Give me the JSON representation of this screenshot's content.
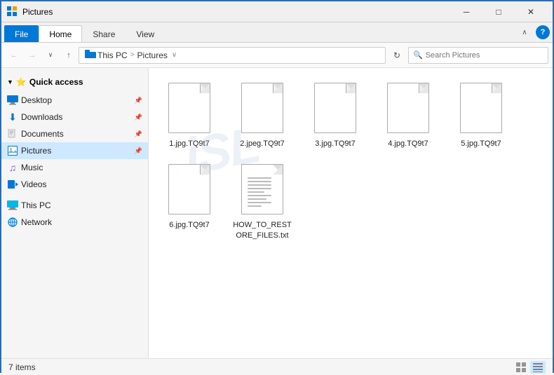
{
  "window": {
    "title": "Pictures",
    "icon": "📁"
  },
  "title_bar": {
    "title": "Pictures",
    "minimize": "─",
    "maximize": "□",
    "close": "✕"
  },
  "ribbon": {
    "tabs": [
      "File",
      "Home",
      "Share",
      "View"
    ],
    "active_tab": "Home",
    "file_tab": "File"
  },
  "address_bar": {
    "back": "←",
    "forward": "→",
    "up": "↑",
    "recent_dropdown": "∨",
    "path": "This PC  ›  Pictures",
    "path_parts": [
      "This PC",
      "Pictures"
    ],
    "dropdown_arrow": "∨",
    "refresh": "⟳",
    "search_placeholder": "Search Pictures"
  },
  "sidebar": {
    "quick_access_label": "Quick access",
    "items": [
      {
        "id": "desktop",
        "label": "Desktop",
        "icon": "🖥",
        "pinned": true
      },
      {
        "id": "downloads",
        "label": "Downloads",
        "icon": "⬇",
        "pinned": true
      },
      {
        "id": "documents",
        "label": "Documents",
        "icon": "📄",
        "pinned": true
      },
      {
        "id": "pictures",
        "label": "Pictures",
        "icon": "🖼",
        "pinned": true,
        "active": true
      },
      {
        "id": "music",
        "label": "Music",
        "icon": "🎵",
        "pinned": false
      },
      {
        "id": "videos",
        "label": "Videos",
        "icon": "📹",
        "pinned": false
      },
      {
        "id": "this-pc",
        "label": "This PC",
        "icon": "💻",
        "pinned": false
      },
      {
        "id": "network",
        "label": "Network",
        "icon": "🌐",
        "pinned": false
      }
    ]
  },
  "files": [
    {
      "id": 1,
      "name": "1.jpg.TQ9t7",
      "type": "doc"
    },
    {
      "id": 2,
      "name": "2.jpeg.TQ9t7",
      "type": "doc"
    },
    {
      "id": 3,
      "name": "3.jpg.TQ9t7",
      "type": "doc"
    },
    {
      "id": 4,
      "name": "4.jpg.TQ9t7",
      "type": "doc"
    },
    {
      "id": 5,
      "name": "5.jpg.TQ9t7",
      "type": "doc"
    },
    {
      "id": 6,
      "name": "6.jpg.TQ9t7",
      "type": "doc"
    },
    {
      "id": 7,
      "name": "HOW_TO_RESTORE_FILES.txt",
      "type": "txt"
    }
  ],
  "status_bar": {
    "item_count": "7 items",
    "view_grid_label": "Grid view",
    "view_list_label": "Details view"
  }
}
